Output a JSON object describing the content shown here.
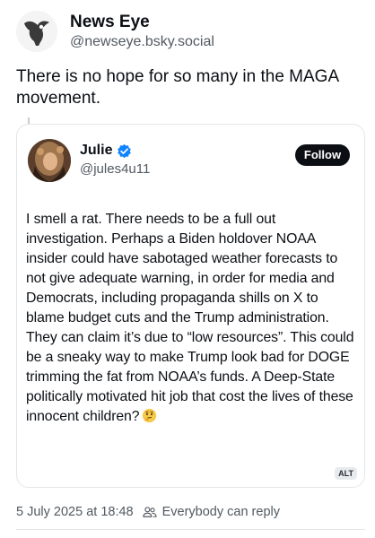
{
  "post": {
    "author_name": "News Eye",
    "author_handle": "@newseye.bsky.social",
    "text": "There is no hope for so many in the MAGA movement.",
    "timestamp": "5 July 2025 at 18:48",
    "reply_setting": "Everybody can reply"
  },
  "quote": {
    "author_name": "Julie",
    "author_handle": "@jules4u11",
    "follow_label": "Follow",
    "text": "I smell a rat. There needs to be a full out investigation. Perhaps a Biden holdover NOAA insider could have sabotaged weather forecasts to not give adequate warning, in order for media and Democrats, including propaganda shills on X to blame budget cuts and the Trump administration. They can claim it’s due to “low resources”. This could be a sneaky way to make Trump look bad for DOGE trimming the fat from NOAA’s funds. A Deep-State politically motivated hit job that cost the lives of these innocent children?",
    "alt_badge": "ALT",
    "verified": true,
    "emoji": "thinking-face-icon"
  },
  "colors": {
    "verified_blue": "#1083fe",
    "secondary_text": "#525960",
    "border": "#e3e6ea"
  }
}
